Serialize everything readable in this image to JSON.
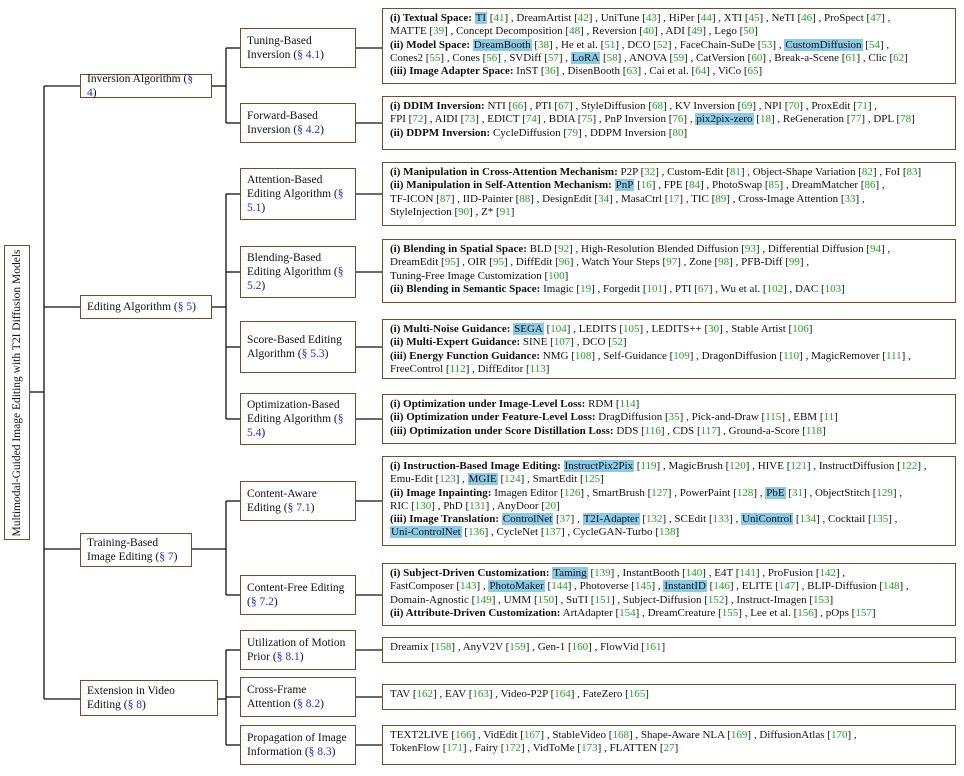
{
  "root": "Multimodal-Guided Image Editing with T2I Diffusion Models",
  "categories": [
    {
      "id": "c1",
      "label": "Inversion Algorithm",
      "sec": "§ 4"
    },
    {
      "id": "c2",
      "label": "Editing Algorithm",
      "sec": "§ 5"
    },
    {
      "id": "c3",
      "label": "Training-Based Image Editing",
      "sec": "§ 7"
    },
    {
      "id": "c4",
      "label": "Extension in Video Editing",
      "sec": "§ 8"
    }
  ],
  "subcategories": [
    {
      "id": "s1",
      "label": "Tuning-Based Inversion",
      "sec": "§ 4.1"
    },
    {
      "id": "s2",
      "label": "Forward-Based Inversion",
      "sec": "§ 4.2"
    },
    {
      "id": "s3",
      "label": "Attention-Based Editing Algorithm",
      "sec": "§ 5.1"
    },
    {
      "id": "s4",
      "label": "Blending-Based Editing Algorithm",
      "sec": "§ 5.2"
    },
    {
      "id": "s5",
      "label": "Score-Based Editing Algorithm",
      "sec": "§ 5.3"
    },
    {
      "id": "s6",
      "label": "Optimization-Based Editing Algorithm",
      "sec": "§ 5.4"
    },
    {
      "id": "s7",
      "label": "Content-Aware Editing",
      "sec": "§ 7.1"
    },
    {
      "id": "s8",
      "label": "Content-Free Editing",
      "sec": "§ 7.2"
    },
    {
      "id": "s9",
      "label": "Utilization of Motion Prior",
      "sec": "§ 8.1"
    },
    {
      "id": "s10",
      "label": "Cross-Frame Attention",
      "sec": "§ 8.2"
    },
    {
      "id": "s11",
      "label": "Propagation of Image Information",
      "sec": "§ 8.3"
    }
  ],
  "leaves": [
    {
      "id": "l1",
      "lines": [
        [
          {
            "h": "(i) Textual Space:"
          },
          {
            "t": "TI",
            "r": "41",
            "hl": true
          },
          {
            "t": "DreamArtist",
            "r": "42"
          },
          {
            "t": "UniTune",
            "r": "43"
          },
          {
            "t": "HiPer",
            "r": "44"
          },
          {
            "t": "XTI",
            "r": "45"
          },
          {
            "t": "NeTI",
            "r": "46"
          },
          {
            "t": "ProSpect",
            "r": "47"
          }
        ],
        [
          {
            "t": "MATTE",
            "r": "39"
          },
          {
            "t": "Concept Decomposition",
            "r": "48"
          },
          {
            "t": "Reversion",
            "r": "40"
          },
          {
            "t": "ADI",
            "r": "49"
          },
          {
            "t": "Lego",
            "r": "50"
          }
        ],
        [
          {
            "h": "(ii) Model Space:"
          },
          {
            "t": "DreamBooth",
            "r": "38",
            "hl": true
          },
          {
            "t": "He et al.",
            "r": "51"
          },
          {
            "t": "DCO",
            "r": "52"
          },
          {
            "t": "FaceChain-SuDe",
            "r": "53"
          },
          {
            "t": "CustomDiffusion",
            "r": "54",
            "hl": true
          }
        ],
        [
          {
            "t": "Cones2",
            "r": "55"
          },
          {
            "t": "Cones",
            "r": "56"
          },
          {
            "t": "SVDiff",
            "r": "57"
          },
          {
            "t": "LoRA",
            "r": "58",
            "hl": true
          },
          {
            "t": "ANOVA",
            "r": "59"
          },
          {
            "t": "CatVersion",
            "r": "60"
          },
          {
            "t": "Break-a-Scene",
            "r": "61"
          },
          {
            "t": "Clic",
            "r": "62"
          }
        ],
        [
          {
            "h": "(iii) Image Adapter Space:"
          },
          {
            "t": "InST",
            "r": "36"
          },
          {
            "t": "DisenBooth",
            "r": "63"
          },
          {
            "t": "Cai et al.",
            "r": "64"
          },
          {
            "t": "ViCo",
            "r": "65"
          }
        ]
      ]
    },
    {
      "id": "l2",
      "lines": [
        [
          {
            "h": "(i) DDIM Inversion:"
          },
          {
            "t": "NTI",
            "r": "66"
          },
          {
            "t": "PTI",
            "r": "67"
          },
          {
            "t": "StyleDiffusion",
            "r": "68"
          },
          {
            "t": "KV Inversion",
            "r": "69"
          },
          {
            "t": "NPI",
            "r": "70"
          },
          {
            "t": "ProxEdit",
            "r": "71"
          }
        ],
        [
          {
            "t": "FPI",
            "r": "72"
          },
          {
            "t": "AIDI",
            "r": "73"
          },
          {
            "t": "EDICT",
            "r": "74"
          },
          {
            "t": "BDIA",
            "r": "75"
          },
          {
            "t": "PnP Inversion",
            "r": "76"
          },
          {
            "t": "pix2pix-zero",
            "r": "18",
            "hl": true
          },
          {
            "t": "ReGeneration",
            "r": "77"
          },
          {
            "t": "DPL",
            "r": "78"
          }
        ],
        [
          {
            "h": "(ii) DDPM Inversion:"
          },
          {
            "t": "CycleDiffusion",
            "r": "79"
          },
          {
            "t": "DDPM Inversion",
            "r": "80"
          }
        ]
      ]
    },
    {
      "id": "l3",
      "lines": [
        [
          {
            "h": "(i) Manipulation in Cross-Attention Mechanism:"
          },
          {
            "t": "P2P",
            "r": "32"
          },
          {
            "t": "Custom-Edit",
            "r": "81"
          },
          {
            "t": "Object-Shape Variation",
            "r": "82"
          },
          {
            "t": "FoI",
            "r": "83"
          }
        ],
        [
          {
            "h": "(ii) Manipulation in Self-Attention Mechanism:"
          },
          {
            "t": "PnP",
            "r": "16",
            "hl": true
          },
          {
            "t": "FPE",
            "r": "84"
          },
          {
            "t": "PhotoSwap",
            "r": "85"
          },
          {
            "t": "DreamMatcher",
            "r": "86"
          }
        ],
        [
          {
            "t": "TF-ICON",
            "r": "87"
          },
          {
            "t": "IID-Painter",
            "r": "88"
          },
          {
            "t": "DesignEdit",
            "r": "34"
          },
          {
            "t": "MasaCtrl",
            "r": "17"
          },
          {
            "t": "TIC",
            "r": "89"
          },
          {
            "t": "Cross-Image Attention",
            "r": "33"
          }
        ],
        [
          {
            "t": "StyleInjection",
            "r": "90"
          },
          {
            "t": "Z*",
            "r": "91"
          }
        ]
      ]
    },
    {
      "id": "l4",
      "lines": [
        [
          {
            "h": "(i) Blending in Spatial Space:"
          },
          {
            "t": "BLD",
            "r": "92"
          },
          {
            "t": "High-Resolution Blended Diffusion",
            "r": "93"
          },
          {
            "t": "Differential Diffusion",
            "r": "94"
          }
        ],
        [
          {
            "t": "DreamEdit",
            "r": "95"
          },
          {
            "t": "OIR",
            "r": "95"
          },
          {
            "t": "DiffEdit",
            "r": "96"
          },
          {
            "t": "Watch Your Steps",
            "r": "97"
          },
          {
            "t": "Zone",
            "r": "98"
          },
          {
            "t": "PFB-Diff",
            "r": "99"
          }
        ],
        [
          {
            "t": "Tuning-Free Image Customization",
            "r": "100"
          }
        ],
        [
          {
            "h": "(ii) Blending in Semantic Space:"
          },
          {
            "t": "Imagic",
            "r": "19"
          },
          {
            "t": "Forgedit",
            "r": "101"
          },
          {
            "t": "PTI",
            "r": "67"
          },
          {
            "t": "Wu et al.",
            "r": "102"
          },
          {
            "t": "DAC",
            "r": "103"
          }
        ]
      ]
    },
    {
      "id": "l5",
      "lines": [
        [
          {
            "h": "(i) Multi-Noise Guidance:"
          },
          {
            "t": "SEGA",
            "r": "104",
            "hl": true
          },
          {
            "t": "LEDITS",
            "r": "105"
          },
          {
            "t": "LEDITS++",
            "r": "30"
          },
          {
            "t": "Stable Artist",
            "r": "106"
          }
        ],
        [
          {
            "h": "(ii) Multi-Expert Guidance:"
          },
          {
            "t": "SINE",
            "r": "107"
          },
          {
            "t": "DCO",
            "r": "52"
          }
        ],
        [
          {
            "h": "(iii) Energy Function Guidance:"
          },
          {
            "t": "NMG",
            "r": "108"
          },
          {
            "t": "Self-Guidance",
            "r": "109"
          },
          {
            "t": "DragonDiffusion",
            "r": "110"
          },
          {
            "t": "MagicRemover",
            "r": "111"
          }
        ],
        [
          {
            "t": "FreeControl",
            "r": "112"
          },
          {
            "t": "DiffEditor",
            "r": "113"
          }
        ]
      ]
    },
    {
      "id": "l6",
      "lines": [
        [
          {
            "h": "(i) Optimization under Image-Level Loss:"
          },
          {
            "t": "RDM",
            "r": "114"
          }
        ],
        [
          {
            "h": "(ii) Optimization under Feature-Level Loss:"
          },
          {
            "t": "DragDiffusion",
            "r": "35"
          },
          {
            "t": "Pick-and-Draw",
            "r": "115"
          },
          {
            "t": "EBM",
            "r": "11"
          }
        ],
        [
          {
            "h": "(iii) Optimization under Score Distillation Loss:"
          },
          {
            "t": "DDS",
            "r": "116"
          },
          {
            "t": "CDS",
            "r": "117"
          },
          {
            "t": "Ground-a-Score",
            "r": "118"
          }
        ]
      ]
    },
    {
      "id": "l7",
      "lines": [
        [
          {
            "h": "(i) Instruction-Based Image Editing:"
          },
          {
            "t": "InstructPix2Pix",
            "r": "119",
            "hl": true
          },
          {
            "t": "MagicBrush",
            "r": "120"
          },
          {
            "t": "HIVE",
            "r": "121"
          },
          {
            "t": "InstructDiffusion",
            "r": "122"
          }
        ],
        [
          {
            "t": "Emu-Edit",
            "r": "123"
          },
          {
            "t": "MGIE",
            "r": "124",
            "hl": true
          },
          {
            "t": "SmartEdit",
            "r": "125"
          }
        ],
        [
          {
            "h": "(ii) Image Inpainting:"
          },
          {
            "t": "Imagen Editor",
            "r": "126"
          },
          {
            "t": "SmartBrush",
            "r": "127"
          },
          {
            "t": "PowerPaint",
            "r": "128"
          },
          {
            "t": "PbE",
            "r": "31",
            "hl": true
          },
          {
            "t": "ObjectStitch",
            "r": "129"
          }
        ],
        [
          {
            "t": "RIC",
            "r": "130"
          },
          {
            "t": "PhD",
            "r": "131"
          },
          {
            "t": "AnyDoor",
            "r": "20"
          }
        ],
        [
          {
            "h": "(iii) Image Translation:"
          },
          {
            "t": "ControlNet",
            "r": "37",
            "hl": true
          },
          {
            "t": "T2I-Adapter",
            "r": "132",
            "hl": true
          },
          {
            "t": "SCEdit",
            "r": "133"
          },
          {
            "t": "UniControl",
            "r": "134",
            "hl": true
          },
          {
            "t": "Cocktail",
            "r": "135"
          }
        ],
        [
          {
            "t": "Uni-ControlNet",
            "r": "136",
            "hl": true
          },
          {
            "t": "CycleNet",
            "r": "137"
          },
          {
            "t": "CycleGAN-Turbo",
            "r": "138"
          }
        ]
      ]
    },
    {
      "id": "l8",
      "lines": [
        [
          {
            "h": "(i) Subject-Driven Customization:"
          },
          {
            "t": "Taming",
            "r": "139",
            "hl": true
          },
          {
            "t": "InstantBooth",
            "r": "140"
          },
          {
            "t": "E4T",
            "r": "141"
          },
          {
            "t": "ProFusion",
            "r": "142"
          }
        ],
        [
          {
            "t": "FastComposer",
            "r": "143"
          },
          {
            "t": "PhotoMaker",
            "r": "144",
            "hl": true
          },
          {
            "t": "Photoverse",
            "r": "145"
          },
          {
            "t": "InstantID",
            "r": "146",
            "hl": true
          },
          {
            "t": "ELITE",
            "r": "147"
          },
          {
            "t": "BLIP-Diffusion",
            "r": "148"
          }
        ],
        [
          {
            "t": "Domain-Agnostic",
            "r": "149"
          },
          {
            "t": "UMM",
            "r": "150"
          },
          {
            "t": "SuTI",
            "r": "151"
          },
          {
            "t": "Subject-Diffusion",
            "r": "152"
          },
          {
            "t": "Instruct-Imagen",
            "r": "153"
          }
        ],
        [
          {
            "h": "(ii) Attribute-Driven Customization:"
          },
          {
            "t": "ArtAdapter",
            "r": "154"
          },
          {
            "t": "DreamCreature",
            "r": "155"
          },
          {
            "t": "Lee et al.",
            "r": "156"
          },
          {
            "t": "pOps",
            "r": "157"
          }
        ]
      ]
    },
    {
      "id": "l9",
      "lines": [
        [
          {
            "t": "Dreamix",
            "r": "158"
          },
          {
            "t": "AnyV2V",
            "r": "159"
          },
          {
            "t": "Gen-1",
            "r": "160"
          },
          {
            "t": "FlowVid",
            "r": "161"
          }
        ]
      ]
    },
    {
      "id": "l10",
      "lines": [
        [
          {
            "t": "TAV",
            "r": "162"
          },
          {
            "t": "EAV",
            "r": "163"
          },
          {
            "t": "Video-P2P",
            "r": "164"
          },
          {
            "t": "FateZero",
            "r": "165"
          }
        ]
      ]
    },
    {
      "id": "l11",
      "lines": [
        [
          {
            "t": "TEXT2LIVE",
            "r": "166"
          },
          {
            "t": "VidEdit",
            "r": "167"
          },
          {
            "t": "StableVideo",
            "r": "168"
          },
          {
            "t": "Shape-Aware NLA",
            "r": "169"
          },
          {
            "t": "DiffusionAtlas",
            "r": "170"
          }
        ],
        [
          {
            "t": "TokenFlow",
            "r": "171"
          },
          {
            "t": "Fairy",
            "r": "172"
          },
          {
            "t": "VidToMe",
            "r": "173"
          },
          {
            "t": "FLATTEN",
            "r": "27"
          }
        ]
      ]
    }
  ]
}
